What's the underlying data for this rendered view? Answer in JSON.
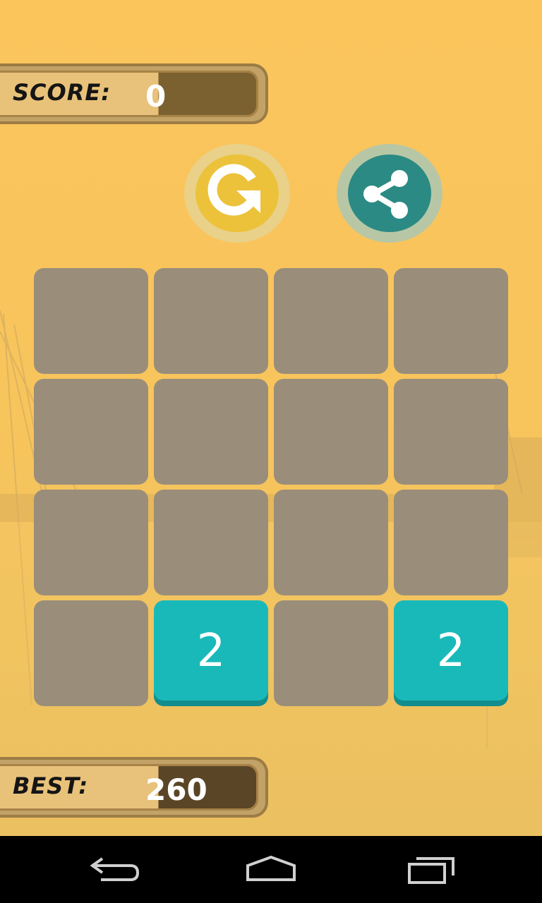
{
  "score": {
    "label": "SCORE:",
    "value": "0"
  },
  "best": {
    "label": "BEST:",
    "value": "260"
  },
  "buttons": {
    "restart_icon": "restart-icon",
    "share_icon": "share-icon"
  },
  "board": {
    "rows": [
      [
        "",
        "",
        "",
        ""
      ],
      [
        "",
        "",
        "",
        ""
      ],
      [
        "",
        "",
        "",
        ""
      ],
      [
        "",
        "2",
        "",
        "2"
      ]
    ]
  },
  "colors": {
    "background": "#fbc55c",
    "empty_tile": "#9a8e7a",
    "tile_2": "#19b9b9",
    "restart": "#ecc23a",
    "share": "#2b8a84"
  },
  "navbar": {
    "back_icon": "back-icon",
    "home_icon": "home-icon",
    "recents_icon": "recents-icon"
  }
}
